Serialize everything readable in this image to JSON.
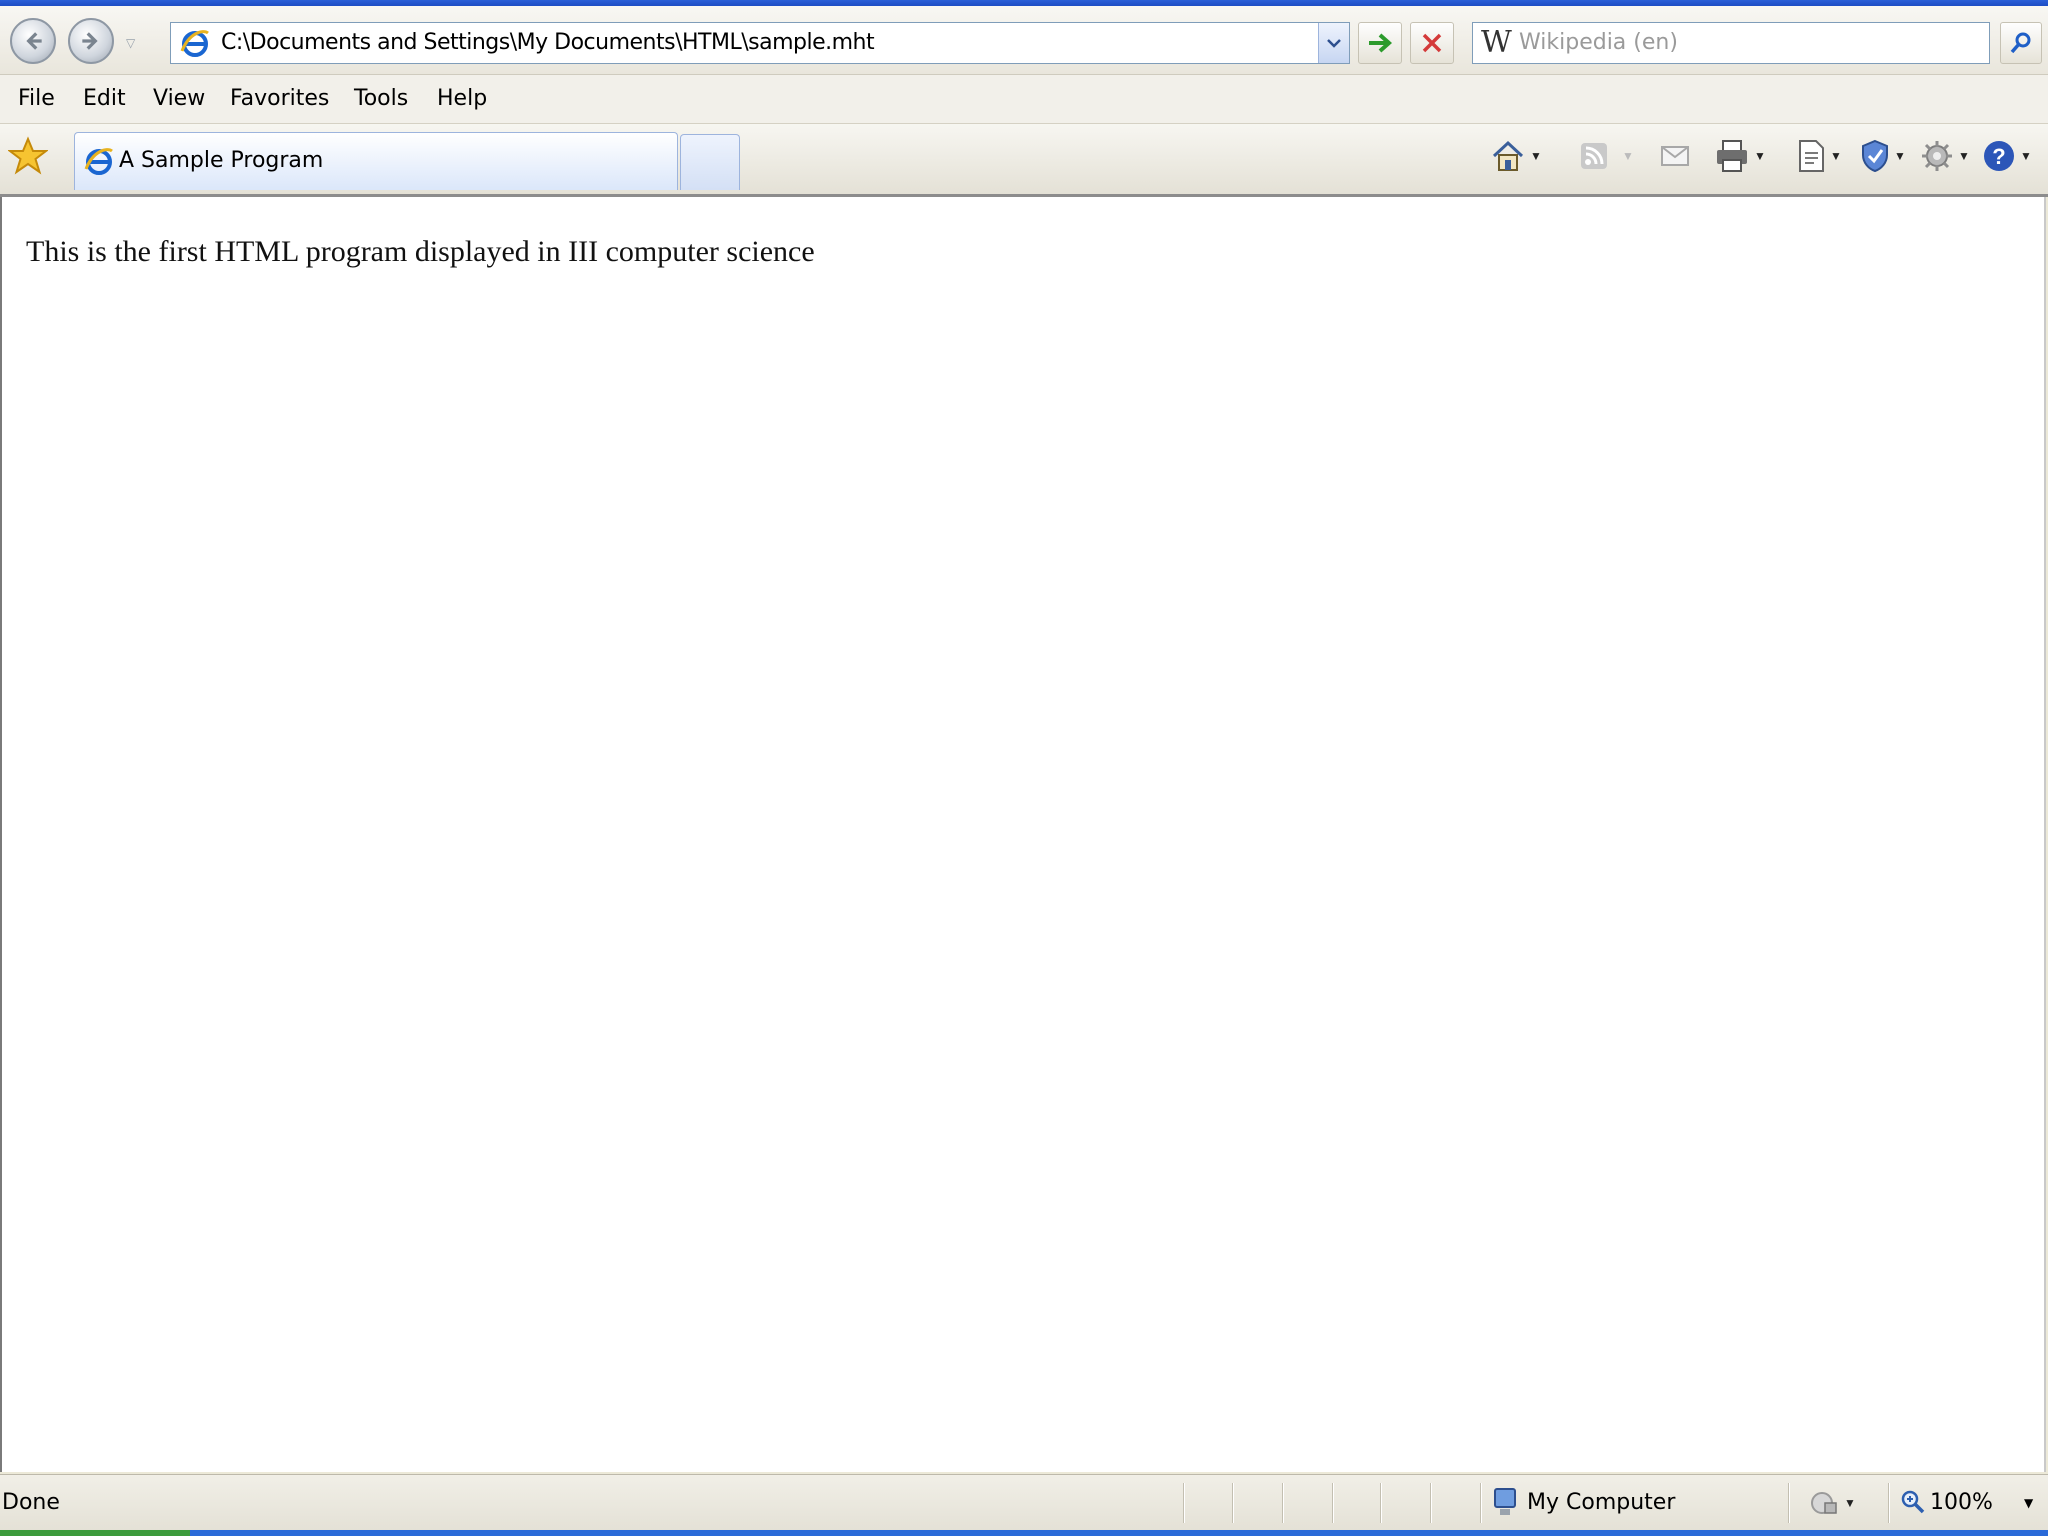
{
  "browser": {
    "address": "C:\\Documents and Settings\\My Documents\\HTML\\sample.mht",
    "search_placeholder": "Wikipedia (en)",
    "search_provider_glyph": "W",
    "menu": [
      "File",
      "Edit",
      "View",
      "Favorites",
      "Tools",
      "Help"
    ],
    "tab_title": "A Sample Program"
  },
  "page": {
    "content_text": "This is the first HTML program displayed in III computer science"
  },
  "status": {
    "text": "Done",
    "zone": "My Computer",
    "zoom": "100%"
  },
  "icons": {
    "back": "back-icon",
    "forward": "forward-icon",
    "go": "go-arrow-icon",
    "stop": "stop-icon",
    "search": "search-magnifier-icon",
    "favorites": "favorites-star-icon",
    "home": "home-icon",
    "feeds": "feeds-icon",
    "mail": "mail-icon",
    "print": "print-icon",
    "page": "page-icon",
    "safety": "safety-shield-icon",
    "tools": "tools-gear-icon",
    "help": "help-icon"
  },
  "colors": {
    "ie_blue": "#1a66d1",
    "go_green": "#2c9b2c",
    "stop_red": "#d43a3a"
  }
}
